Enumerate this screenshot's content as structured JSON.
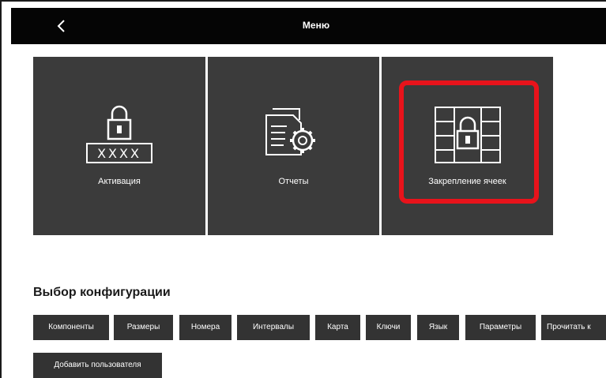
{
  "header": {
    "back_icon": "chevron-left-icon",
    "title": "Меню"
  },
  "tiles": [
    {
      "label": "Активация",
      "icon": "lock-keypad-icon",
      "keypad_text": "XXXX"
    },
    {
      "label": "Отчеты",
      "icon": "document-gear-icon"
    },
    {
      "label": "Закрепление ячеек",
      "icon": "locker-lock-icon"
    }
  ],
  "highlight_color": "#e8131b",
  "config": {
    "title": "Выбор конфигурации",
    "buttons": [
      "Компоненты",
      "Размеры",
      "Номера",
      "Интервалы",
      "Карта",
      "Ключи",
      "Язык",
      "Параметры",
      "Прочитать к",
      "Добавить пользователя"
    ]
  }
}
